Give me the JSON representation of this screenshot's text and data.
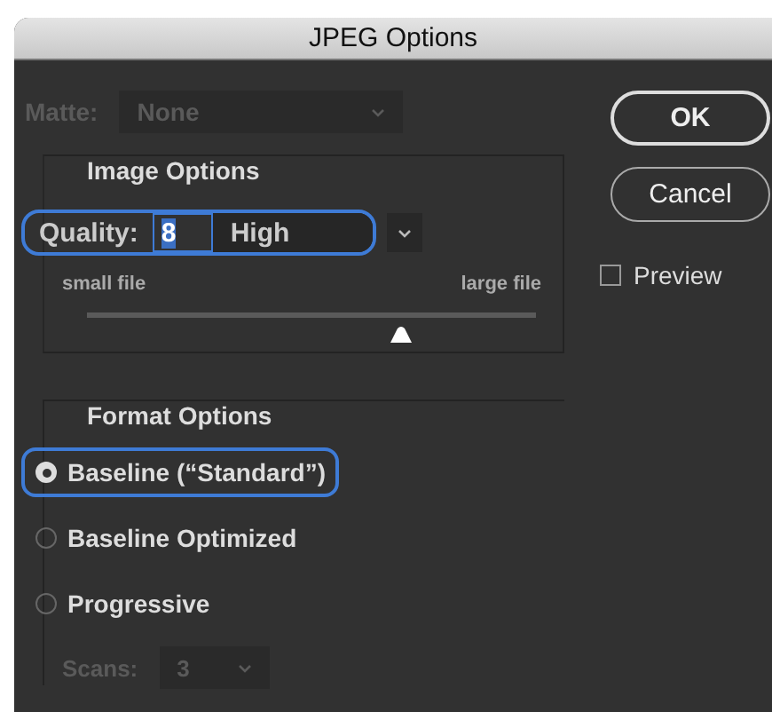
{
  "window": {
    "title": "JPEG Options"
  },
  "matte": {
    "label": "Matte:",
    "value": "None",
    "disabled": true
  },
  "image_options": {
    "title": "Image Options",
    "quality_label": "Quality:",
    "quality_value": "8",
    "quality_preset": "High",
    "min_label": "small file",
    "max_label": "large file",
    "level": 0.7
  },
  "format_options": {
    "title": "Format Options",
    "radios": [
      {
        "label": "Baseline (“Standard”)",
        "selected": true
      },
      {
        "label": "Baseline Optimized",
        "selected": false
      },
      {
        "label": "Progressive",
        "selected": false
      }
    ],
    "scans": {
      "label": "Scans:",
      "value": "3",
      "disabled": true
    }
  },
  "buttons": [
    {
      "label": "OK",
      "kind": "default"
    },
    {
      "label": "Cancel",
      "kind": "normal"
    }
  ],
  "preview": {
    "label": "Preview",
    "checked": false
  }
}
